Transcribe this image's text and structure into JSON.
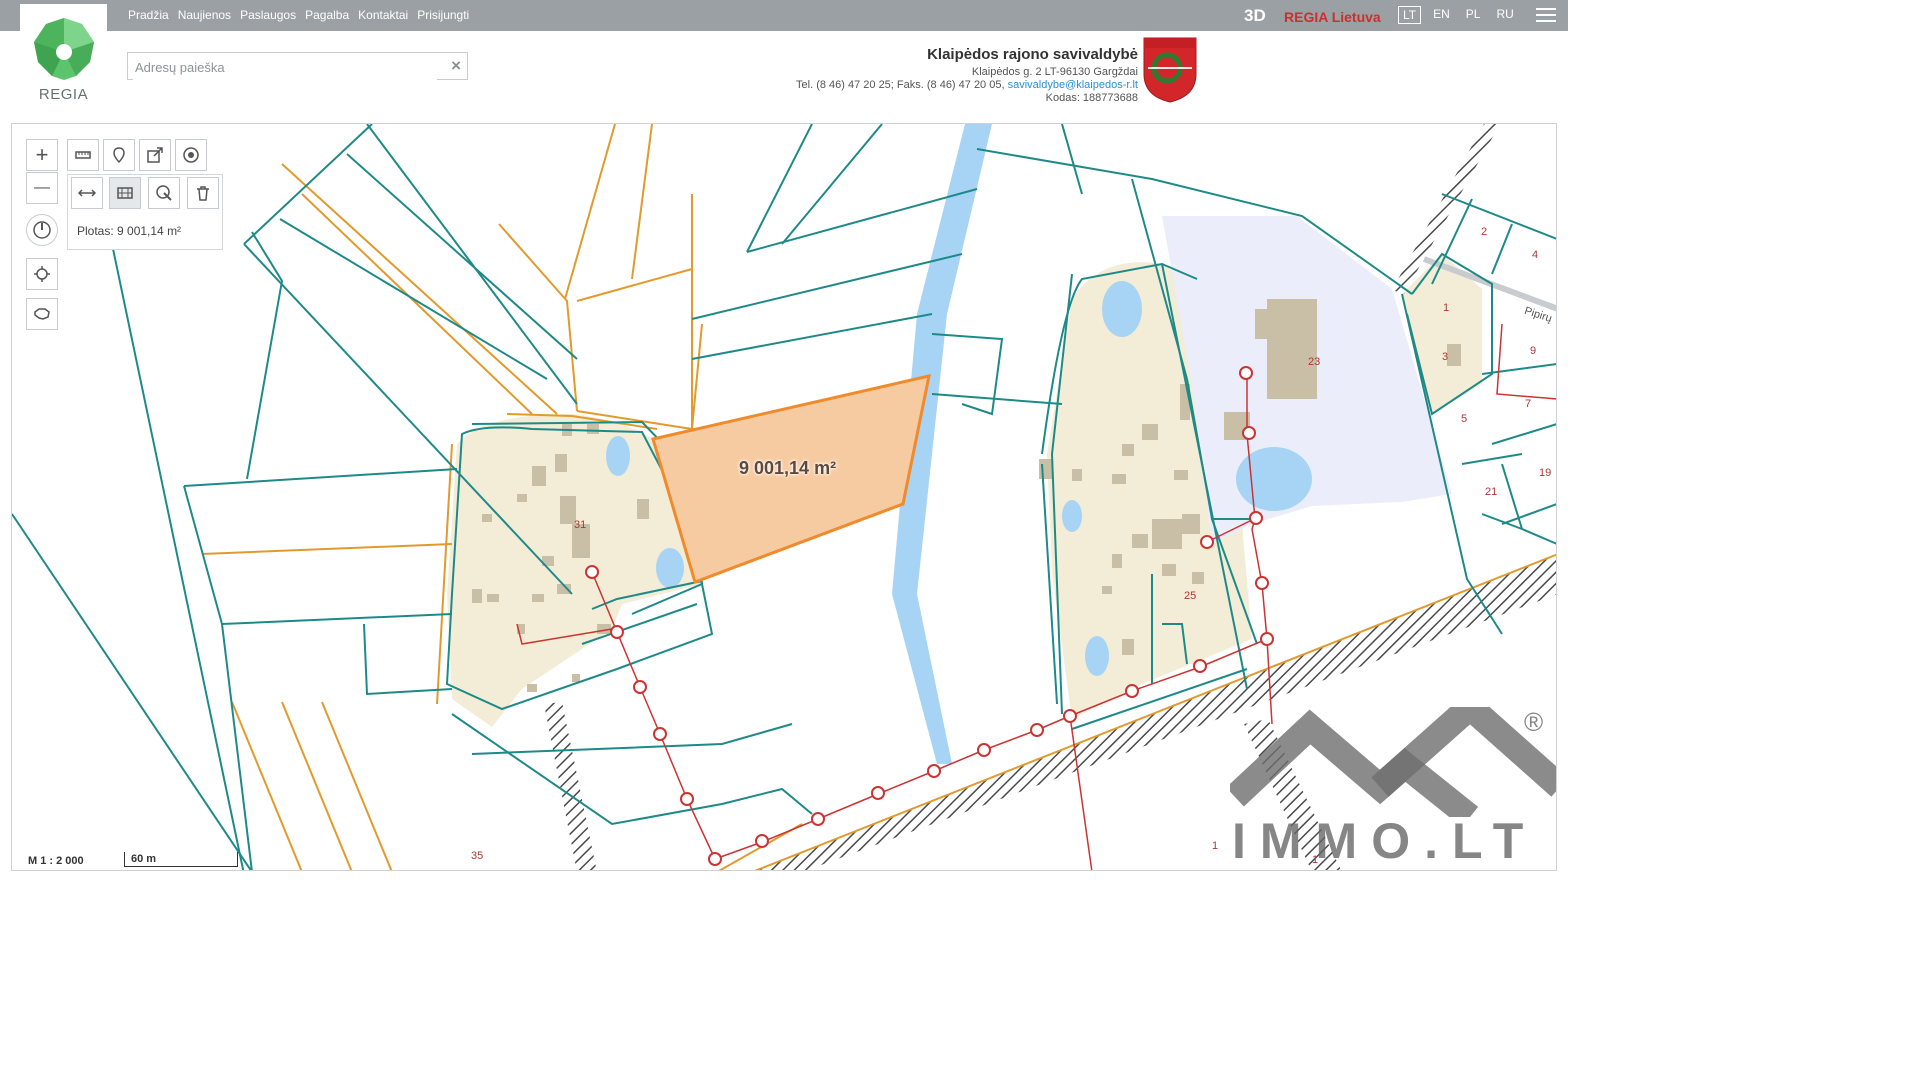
{
  "nav": [
    "Pradžia",
    "Naujienos",
    "Paslaugos",
    "Pagalba",
    "Kontaktai",
    "Prisijungti"
  ],
  "top_right": {
    "mode_3d": "3D",
    "brand": "REGIA Lietuva",
    "languages": [
      "LT",
      "EN",
      "PL",
      "RU"
    ],
    "active_language": "LT"
  },
  "logo": {
    "text": "REGIA",
    "icon": "regia-logo-icon"
  },
  "search": {
    "placeholder": "Adresų paieška",
    "value": "",
    "clear_icon": "×"
  },
  "municipality": {
    "name": "Klaipėdos rajono savivaldybė",
    "address": "Klaipėdos g. 2 LT-96130 Gargždai",
    "contact": "Tel. (8 46) 47 20 25; Faks. (8 46) 47 20 05, ",
    "email": "savivaldybe@klaipedos-r.lt",
    "code": "Kodas: 188773688"
  },
  "map": {
    "selected_area_label": "9 001,14 m²",
    "measure_result": "Plotas: 9 001,14 m²",
    "scale_label": "M 1 : 2 000",
    "scale_bar": "60 m",
    "parcel_numbers": [
      "31",
      "23",
      "25",
      "35",
      "1",
      "2",
      "4",
      "1",
      "3",
      "9",
      "5",
      "7",
      "19",
      "21",
      "1"
    ],
    "street_label": "Pipirų",
    "watermark": "IMMO.LT",
    "watermark_reg": "®"
  },
  "tools": {
    "zoom_in": "+",
    "zoom_out": "—",
    "icons": [
      "measure-distance-icon",
      "pin-icon",
      "share-icon",
      "target-icon",
      "measure-line-icon",
      "measure-area-icon",
      "select-area-icon",
      "trash-icon",
      "compass-icon",
      "locate-icon",
      "lithuania-map-icon"
    ]
  },
  "colors": {
    "topbar": "#9aa0a4",
    "brand_red": "#c9312c",
    "parcel_teal": "#1e8a88",
    "parcel_orange": "#e39a2c",
    "selected_fill": "#f7cba2",
    "selected_stroke": "#f08a2a",
    "yard_fill": "#f3ecd6",
    "water": "#a7d3f4",
    "utility_red": "#cc3333"
  }
}
